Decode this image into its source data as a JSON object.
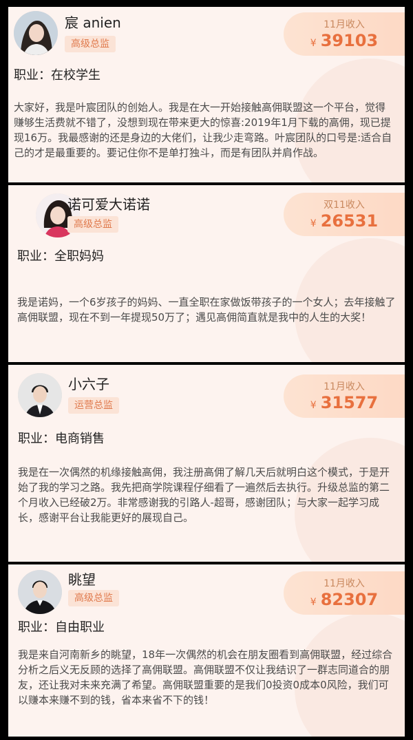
{
  "cards": [
    {
      "name": "宸 anien",
      "title": "高级总监",
      "income_label": "11月收入",
      "currency": "¥",
      "income": "39103",
      "job_label": "职业：",
      "job": "在校学生",
      "bio": "大家好，我是叶宸团队的创始人。我是在大一开始接触高佣联盟这一个平台，觉得赚够生活费就不错了，没想到现在带来更大的惊喜:2019年1月下载的高佣，现已提现16万。我最感谢的还是身边的大佬们，让我少走弯路。叶宸团队的口号是:适合自己的才是最重要的。要记住你不是单打独斗，而是有团队并肩作战。"
    },
    {
      "name": "诺可爱大诺诺",
      "title": "高级总监",
      "income_label": "双11收入",
      "currency": "¥",
      "income": "26531",
      "job_label": "职业：",
      "job": "全职妈妈",
      "bio": "我是诺妈，一个6岁孩子的妈妈、一直全职在家做饭带孩子的一个女人；去年接触了高佣联盟，现在不到一年提现50万了；遇见高佣简直就是我中的人生的大奖！"
    },
    {
      "name": "小六子",
      "title": "运营总监",
      "income_label": "11月收入",
      "currency": "¥",
      "income": "31577",
      "job_label": "职业：",
      "job": "电商销售",
      "bio": "我是在一次偶然的机缘接触高佣，我注册高佣了解几天后就明白这个模式，于是开始了我的学习之路。我先把商学院课程仔细看了一遍然后去执行。升级总监的第二个月收入已经破2万。非常感谢我的引路人-超哥，感谢团队；与大家一起学习成长，感谢平台让我能更好的展现自己。"
    },
    {
      "name": "眺望",
      "title": "高级总监",
      "income_label": "11月收入",
      "currency": "¥",
      "income": "82307",
      "job_label": "职业：",
      "job": "自由职业",
      "bio": "我是来自河南新乡的眺望，18年一次偶然的机会在朋友圈看到高佣联盟，经过综合分析之后义无反顾的选择了高佣联盟。高佣联盟不仅让我结识了一群志同道合的朋友，还让我对未来充满了希望。高佣联盟重要的是我们0投资0成本0风险，我们可以赚本来赚不到的钱，省本来省不下的钱！"
    }
  ]
}
